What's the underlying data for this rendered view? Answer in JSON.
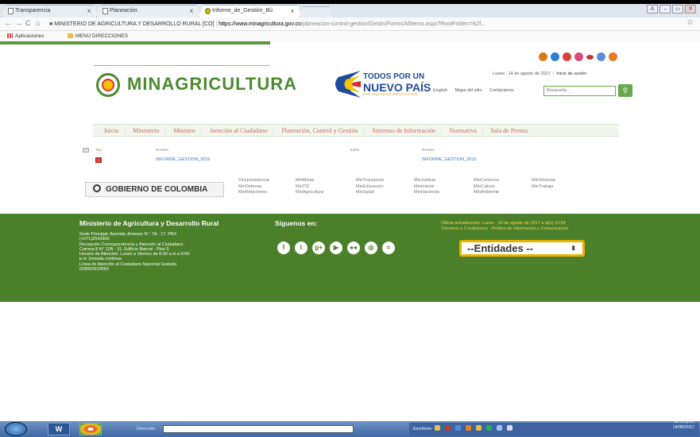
{
  "browser": {
    "tabs": [
      {
        "label": "Transparencia",
        "close": "x"
      },
      {
        "label": "Planeación",
        "close": "x"
      },
      {
        "label": "Informe_de_Gestión_Bú",
        "close": "x"
      }
    ],
    "url_site_name": "MINISTERIO DE AGRICULTURA Y DESARROLLO RURAL [CO]",
    "url_host": "https://www.minagricultura.gov.co",
    "url_path": "/planeacion-control-gestion/Gestin/Forms/AllItems.aspx?RootFolder=%2f...",
    "bookmarks": [
      "Aplicaciones",
      "MENU DIRECCIONES"
    ]
  },
  "site": {
    "logo_text": "MINAGRICULTURA",
    "gov_line1": "TODOS POR UN",
    "gov_line2": "NUEVO PAÍS",
    "gov_tagline": "PAZ   EQUIDAD   EDUCACIÓN",
    "date_text": "Lunes , 14 de agosto de 2017",
    "login_link": "Inicio de sesión",
    "english_link": "English",
    "sitemap_link": "Mapa del sitio",
    "contact_link": "Contáctenos",
    "search_placeholder": "Búsqueda...",
    "social_colors": [
      "#d67a1a",
      "#2f7fd0",
      "#d8413a",
      "#d84a7a",
      "#c0392b",
      "#5b8dd6",
      "#e67e22"
    ]
  },
  "menu": [
    "Inicio",
    "Ministerio",
    "Ministro",
    "Atención al Ciudadano",
    "Planeación, Control y Gestión",
    "Sistemas de Información",
    "Normativa",
    "Sala de Prensa"
  ],
  "list": {
    "headers": [
      "Tipo",
      "Nombre",
      "Editar",
      "Nombre"
    ],
    "row": {
      "name": "INFORME_GESTION_2016",
      "name2": "INFORME_GESTION_2016"
    }
  },
  "gobierno": {
    "label": "GOBIERNO DE COLOMBIA",
    "columns": [
      [
        "Vicepresidencia",
        "MinDefensa",
        "MinRelaciones"
      ],
      [
        "MinMinas",
        "MinTIC",
        "MinAgricultura"
      ],
      [
        "MinTransporte",
        "MinEducación",
        "MinSalud"
      ],
      [
        "MinJusticia",
        "MinInterior",
        "MinHacienda"
      ],
      [
        "MinComercio",
        "MinCultura",
        "MinAmbiente"
      ],
      [
        "MinVivienda",
        "MinTrabajo"
      ]
    ]
  },
  "footer": {
    "title": "Ministerio de Agricultura y Desarrollo Rural",
    "lines": [
      "Sede Principal: Avenida Jimenez N°. 7A - 17. PBX",
      "(+571)2543300",
      "Recepción Correspondencia y Atención al Ciudadano:",
      "Carrera 8 N° 12B - 31, Edificio Bancol - Piso 5",
      "Horario de Atención: Lunes a Viernes de 8:00 a.m a 5:00",
      "p.m Jornada continua",
      "Línea de Atención al Ciudadano Nacional Gratuita",
      "018000510050"
    ],
    "follow_title": "Síguenos en:",
    "update_text": "Última actualización: Lunes , 14 de agosto de 2017 a la(s) 10:54",
    "terms_text": "Términos y Condiciones - Política de Información y Comunicación",
    "entidades_label": "--Entidades --",
    "social_icons": [
      "f",
      "t",
      "g+",
      "▶",
      "●●",
      "◎",
      "≈"
    ]
  },
  "taskbar": {
    "address_label": "Dirección",
    "desktop_label": "Escritorio",
    "time": "08:50 p.m.",
    "date": "14/08/2017"
  }
}
